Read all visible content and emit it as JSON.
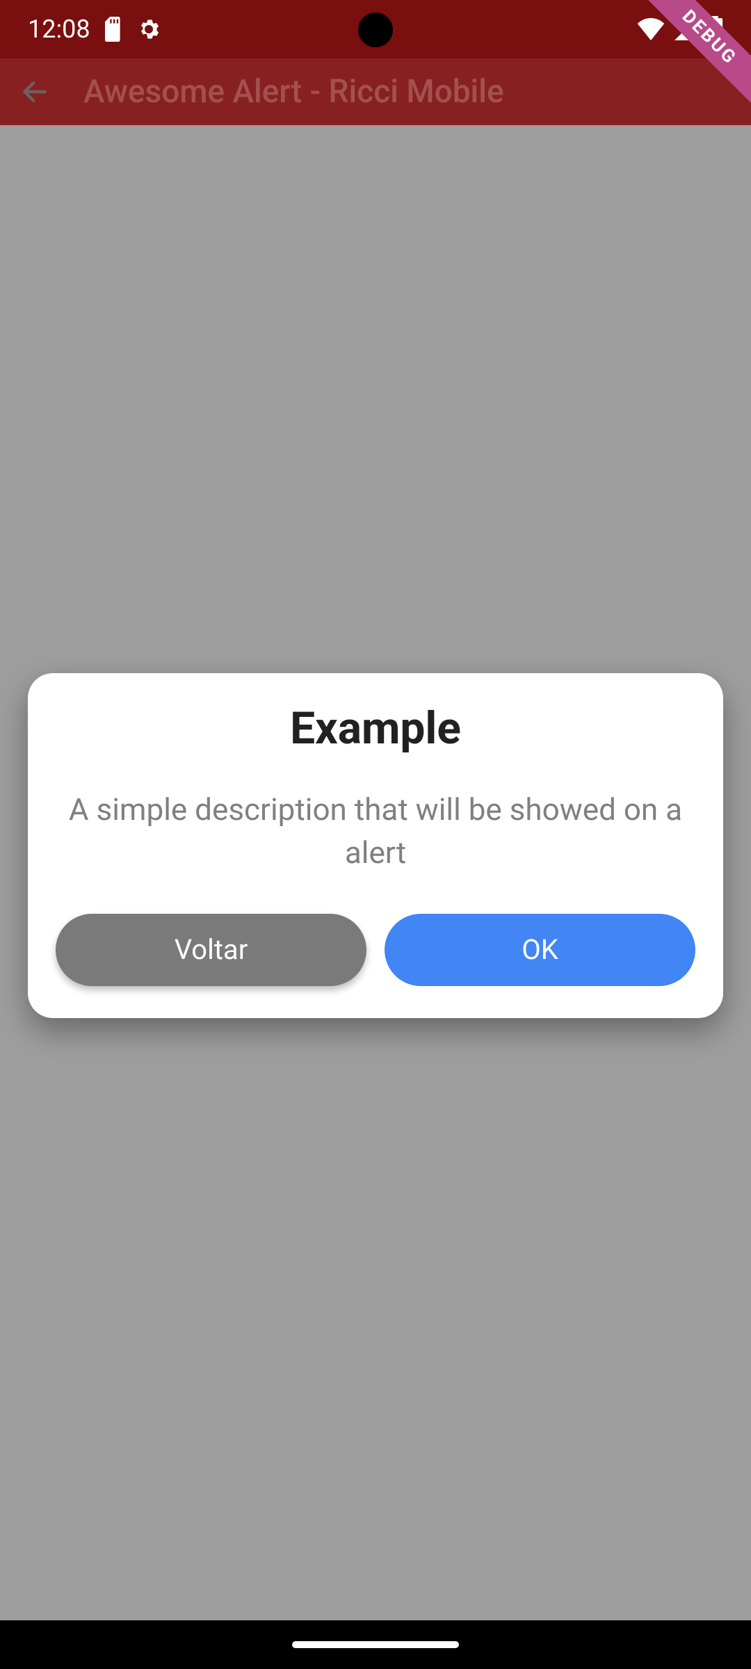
{
  "status": {
    "time": "12:08",
    "debug_label": "DEBUG"
  },
  "appbar": {
    "title": "Awesome Alert - Ricci Mobile"
  },
  "dialog": {
    "title": "Example",
    "description": "A simple description that will be showed on a alert",
    "cancel_label": "Voltar",
    "ok_label": "OK"
  },
  "colors": {
    "primary_button": "#4285f4",
    "cancel_button": "#7a7a7a",
    "appbar_bg": "#872121",
    "statusbar_bg": "#7a0f0f"
  }
}
